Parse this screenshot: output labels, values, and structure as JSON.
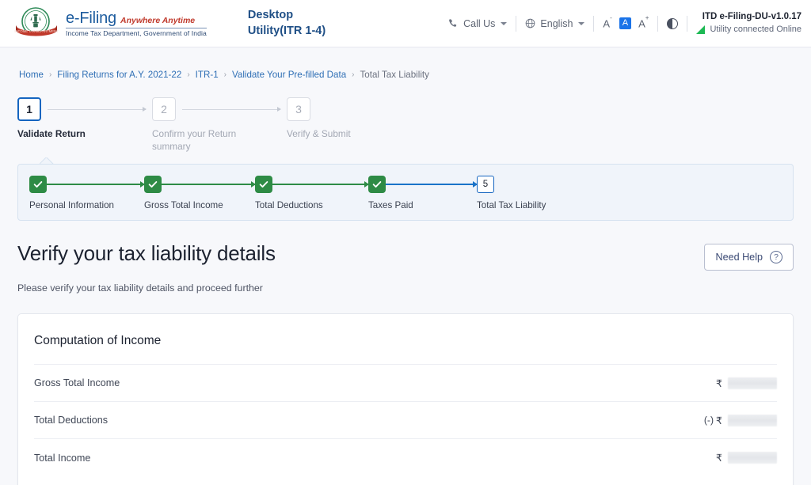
{
  "header": {
    "brand": {
      "emblem_icon": "india-emblem-logo",
      "efiling": "e-Filing",
      "tagline": "Anywhere Anytime",
      "department": "Income Tax Department, Government of India"
    },
    "app_title": "Desktop\nUtility(ITR 1-4)",
    "app_title_line1": "Desktop",
    "app_title_line2": "Utility(ITR 1-4)",
    "call_us": "Call Us",
    "call_us_icon": "phone-icon",
    "language": "English",
    "language_icon": "globe-icon",
    "font_decrease": "A",
    "font_decrease_sup": "-",
    "font_normal": "A",
    "font_increase": "A",
    "font_increase_sup": "+",
    "contrast_icon": "contrast-toggle-icon",
    "version": "ITD e-Filing-DU-v1.0.17",
    "connection_status": "Utility connected Online",
    "signal_icon": "signal-triangle-icon"
  },
  "breadcrumb": {
    "separator": "›",
    "items": [
      {
        "label": "Home",
        "current": false
      },
      {
        "label": "Filing Returns for A.Y. 2021-22",
        "current": false
      },
      {
        "label": "ITR-1",
        "current": false
      },
      {
        "label": "Validate Your Pre-filled Data",
        "current": false
      },
      {
        "label": "Total Tax Liability",
        "current": true
      }
    ]
  },
  "stepper": {
    "steps": [
      {
        "number": "1",
        "label": "Validate Return",
        "state": "active"
      },
      {
        "number": "2",
        "label": "Confirm your Return summary",
        "state": "idle"
      },
      {
        "number": "3",
        "label": "Verify & Submit",
        "state": "idle"
      }
    ]
  },
  "subprogress": {
    "items": [
      {
        "label": "Personal Information",
        "state": "complete",
        "mark": "✔"
      },
      {
        "label": "Gross Total Income",
        "state": "complete",
        "mark": "✔"
      },
      {
        "label": "Total Deductions",
        "state": "complete",
        "mark": "✔"
      },
      {
        "label": "Taxes Paid",
        "state": "complete",
        "mark": "✔"
      },
      {
        "label": "Total Tax Liability",
        "state": "current",
        "mark": "5"
      }
    ]
  },
  "page": {
    "title": "Verify your tax liability details",
    "subtitle": "Please verify your tax liability details and proceed further",
    "need_help": "Need Help",
    "need_help_icon": "question-mark-icon"
  },
  "computation_card": {
    "title": "Computation of Income",
    "rows": [
      {
        "label": "Gross Total Income",
        "prefix": "",
        "currency": "₹",
        "value": ""
      },
      {
        "label": "Total Deductions",
        "prefix": "(-)",
        "currency": "₹",
        "value": ""
      },
      {
        "label": "Total Income",
        "prefix": "",
        "currency": "₹",
        "value": ""
      }
    ]
  },
  "colors": {
    "brand_blue": "#1d5c9e",
    "accent_blue": "#1565c0",
    "link_blue": "#2f6fb5",
    "success_green": "#2e8b45",
    "signal_green": "#1db954",
    "panel_bg": "#f0f4fa",
    "page_bg": "#f7f8fb",
    "tagline_red": "#c0392b"
  }
}
